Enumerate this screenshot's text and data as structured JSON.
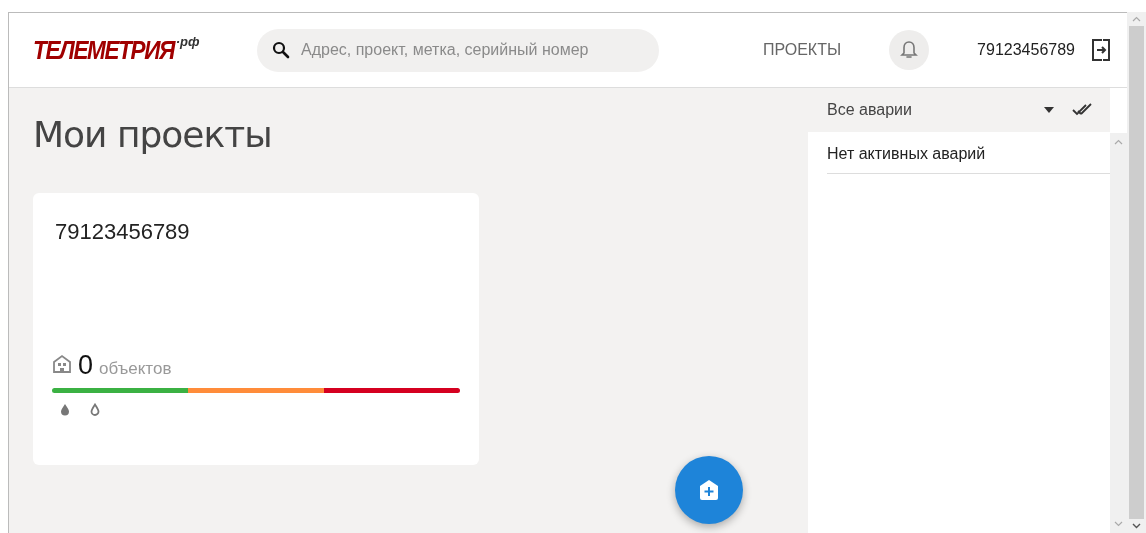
{
  "header": {
    "logo": {
      "name": "ТЕЛЕМЕТРИЯ",
      "suffix": "·рф"
    },
    "search": {
      "placeholder": "Адрес, проект, метка, серийный номер"
    },
    "nav": "ПРОЕКТЫ",
    "user": "79123456789"
  },
  "page": {
    "title": "Мои проекты"
  },
  "projects": [
    {
      "name": "79123456789",
      "count": "0",
      "count_label": "объектов",
      "segments": [
        {
          "color": "#3bb143"
        },
        {
          "color": "#ff8c3a"
        },
        {
          "color": "#d50020"
        }
      ]
    }
  ],
  "alarms": {
    "filter": "Все аварии",
    "empty": "Нет активных аварий"
  }
}
